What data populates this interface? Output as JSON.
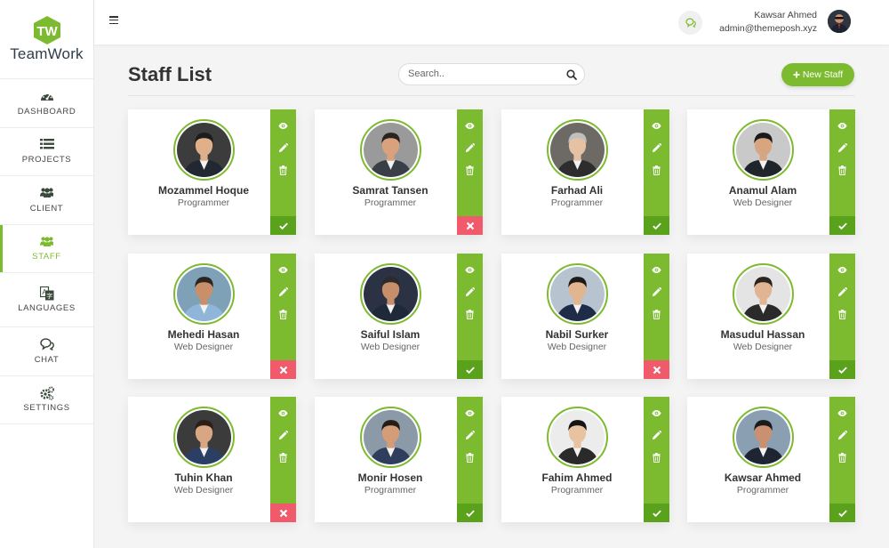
{
  "app": {
    "logo_text": "TeamWork",
    "accent_color": "#7cbb2f"
  },
  "sidebar": {
    "items": [
      {
        "label": "DASHBOARD",
        "icon": "dashboard-gauge-icon",
        "active": false
      },
      {
        "label": "PROJECTS",
        "icon": "list-icon",
        "active": false
      },
      {
        "label": "CLIENT",
        "icon": "users-icon",
        "active": false
      },
      {
        "label": "STAFF",
        "icon": "users-icon",
        "active": true
      },
      {
        "label": "LANGUAGES",
        "icon": "language-icon",
        "active": false
      },
      {
        "label": "CHAT",
        "icon": "chat-icon",
        "active": false
      },
      {
        "label": "SETTINGS",
        "icon": "gears-icon",
        "active": false
      }
    ]
  },
  "topbar": {
    "user_name": "Kawsar Ahmed",
    "user_email": "admin@themeposh.xyz"
  },
  "page": {
    "title": "Staff List",
    "search_placeholder": "Search..",
    "new_button_label": "New Staff"
  },
  "staff": [
    {
      "name": "Mozammel Hoque",
      "role": "Programmer",
      "status": "active"
    },
    {
      "name": "Samrat Tansen",
      "role": "Programmer",
      "status": "inactive"
    },
    {
      "name": "Farhad Ali",
      "role": "Programmer",
      "status": "active"
    },
    {
      "name": "Anamul Alam",
      "role": "Web Designer",
      "status": "active"
    },
    {
      "name": "Mehedi Hasan",
      "role": "Web Designer",
      "status": "inactive"
    },
    {
      "name": "Saiful Islam",
      "role": "Web Designer",
      "status": "active"
    },
    {
      "name": "Nabil Surker",
      "role": "Web Designer",
      "status": "inactive"
    },
    {
      "name": "Masudul Hassan",
      "role": "Web Designer",
      "status": "active"
    },
    {
      "name": "Tuhin Khan",
      "role": "Web Designer",
      "status": "inactive"
    },
    {
      "name": "Monir Hosen",
      "role": "Programmer",
      "status": "active"
    },
    {
      "name": "Fahim Ahmed",
      "role": "Programmer",
      "status": "active"
    },
    {
      "name": "Kawsar Ahmed",
      "role": "Programmer",
      "status": "active"
    }
  ]
}
